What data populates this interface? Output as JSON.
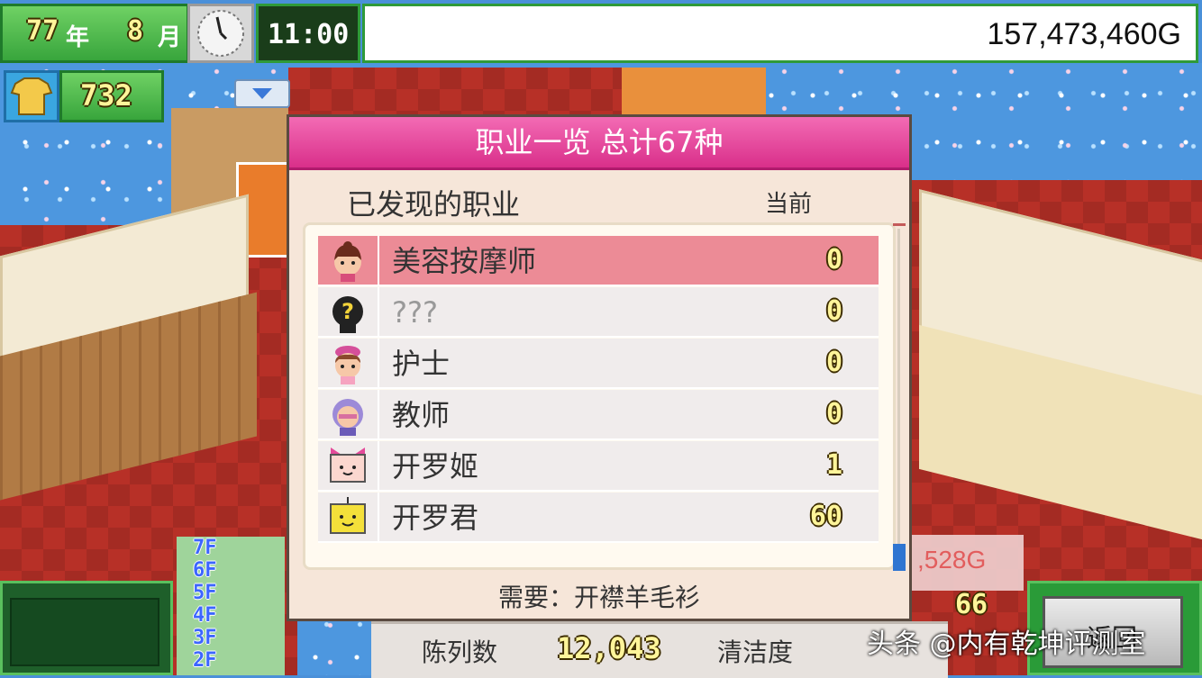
{
  "hud": {
    "year_value": "77",
    "year_unit": "年",
    "month_value": "8",
    "month_unit": "月",
    "clock_time": "11:00",
    "money": "157,473,460G",
    "shirt_count": "732"
  },
  "dialog": {
    "title": "职业一览 总计67种",
    "discovered_label": "已发现的职业",
    "current_label": "当前",
    "requirement": "需要：开襟羊毛衫",
    "jobs": [
      {
        "name": "美容按摩师",
        "count": "0",
        "selected": true
      },
      {
        "name": "???",
        "count": "0",
        "selected": false
      },
      {
        "name": "护士",
        "count": "0",
        "selected": false
      },
      {
        "name": "教师",
        "count": "0",
        "selected": false
      },
      {
        "name": "开罗姬",
        "count": "1",
        "selected": false
      },
      {
        "name": "开罗君",
        "count": "60",
        "selected": false
      }
    ]
  },
  "floors": [
    "7F",
    "6F",
    "5F",
    "4F",
    "3F",
    "2F"
  ],
  "bottom_bar": {
    "display_label": "陈列数",
    "display_value": "12,043",
    "clean_label": "清洁度",
    "right_money_partial": ",528G",
    "right_number": "66",
    "back_button": "返回"
  },
  "watermark": "头条 @内有乾坤评测室"
}
